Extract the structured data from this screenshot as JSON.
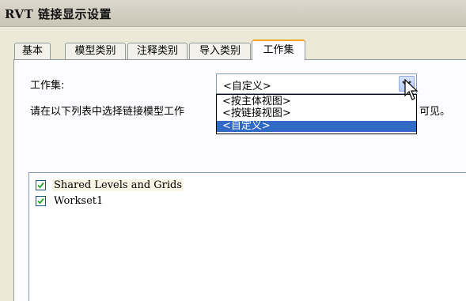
{
  "window": {
    "title": "RVT 链接显示设置"
  },
  "tabs": [
    {
      "label": "基本",
      "active": false
    },
    {
      "label": "模型类别",
      "active": false
    },
    {
      "label": "注释类别",
      "active": false
    },
    {
      "label": "导入类别",
      "active": false
    },
    {
      "label": "工作集",
      "active": true
    }
  ],
  "workset": {
    "label": "工作集:",
    "selected": "<自定义>",
    "options": [
      "<按主体视图>",
      "<按链接视图>",
      "<自定义>"
    ],
    "instruction_prefix": "请在以下列表中选择链接模型工作",
    "instruction_suffix": "可见。"
  },
  "list": {
    "items": [
      {
        "label": "Shared Levels and Grids",
        "checked": true
      },
      {
        "label": "Workset1",
        "checked": true
      }
    ]
  },
  "icons": {
    "combo_button": "chevron-down-icon",
    "cursor": "mouse-pointer-icon",
    "check": "checkmark-icon"
  },
  "colors": {
    "active_tab_accent": "#f7a51c",
    "selection": "#316ac5"
  }
}
